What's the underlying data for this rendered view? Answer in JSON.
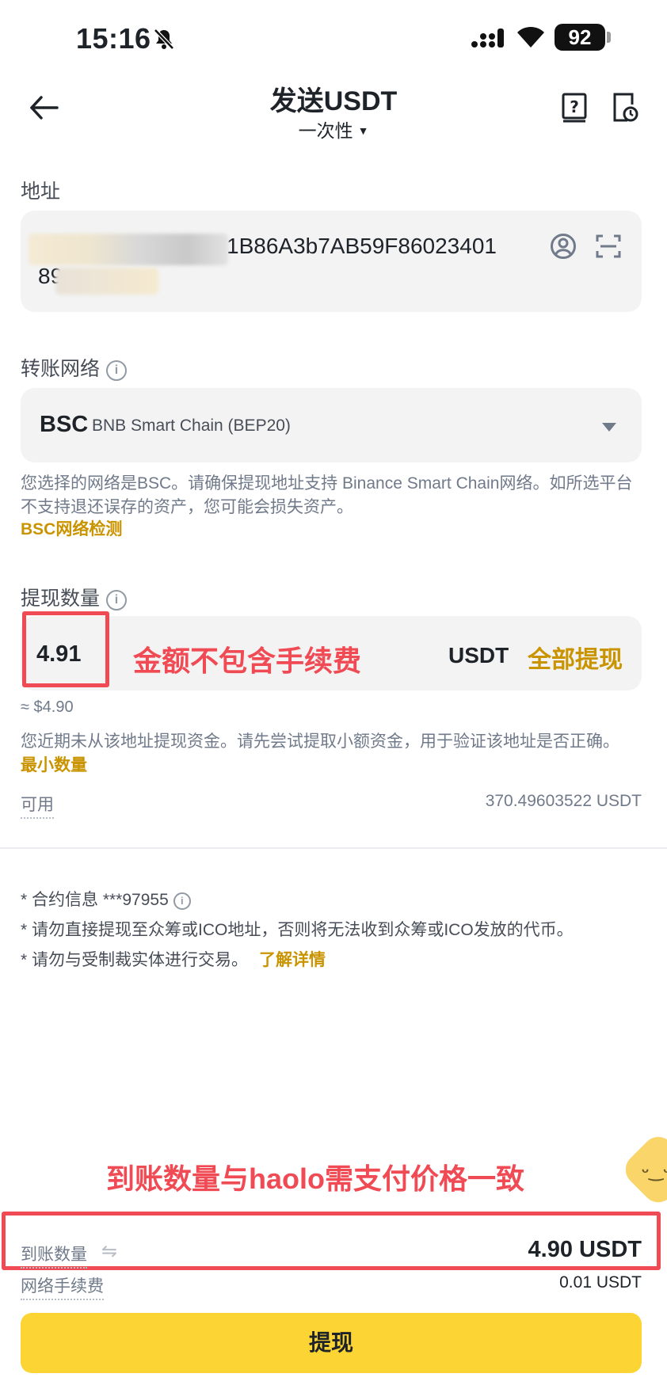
{
  "status_bar": {
    "time": "15:16",
    "battery": "92"
  },
  "header": {
    "title": "发送USDT",
    "subtitle": "一次性"
  },
  "address": {
    "label": "地址",
    "line1_visible": "1B86A3b7AB59F86023401",
    "line2_visible": "89"
  },
  "network": {
    "label": "转账网络",
    "symbol": "BSC",
    "name": "BNB Smart Chain (BEP20)",
    "note": "您选择的网络是BSC。请确保提现地址支持 Binance Smart Chain网络。如所选平台不支持退还误存的资产，您可能会损失资产。",
    "check_link": "BSC网络检测"
  },
  "amount": {
    "label": "提现数量",
    "value": "4.91",
    "annotation": "金额不包含手续费",
    "unit": "USDT",
    "max_label": "全部提现",
    "approx": "≈ $4.90",
    "note": "您近期未从该地址提现资金。请先尝试提取小额资金，用于验证该地址是否正确。",
    "min_link": "最小数量",
    "available_label": "可用",
    "available_value": "370.49603522 USDT"
  },
  "notices": {
    "contract": "* 合约信息 ***97955",
    "line2": "* 请勿直接提现至众筹或ICO地址，否则将无法收到众筹或ICO发放的代币。",
    "line3": "* 请勿与受制裁实体进行交易。",
    "more_link": "了解详情"
  },
  "annotation_bottom": "到账数量与haolo需支付价格一致",
  "summary": {
    "receive_label": "到账数量",
    "receive_value": "4.90 USDT",
    "fee_label": "网络手续费",
    "fee_value": "0.01 USDT"
  },
  "submit_label": "提现",
  "colors": {
    "accent": "#fcd535",
    "link": "#c99400",
    "annotation_red": "#f04b55"
  }
}
